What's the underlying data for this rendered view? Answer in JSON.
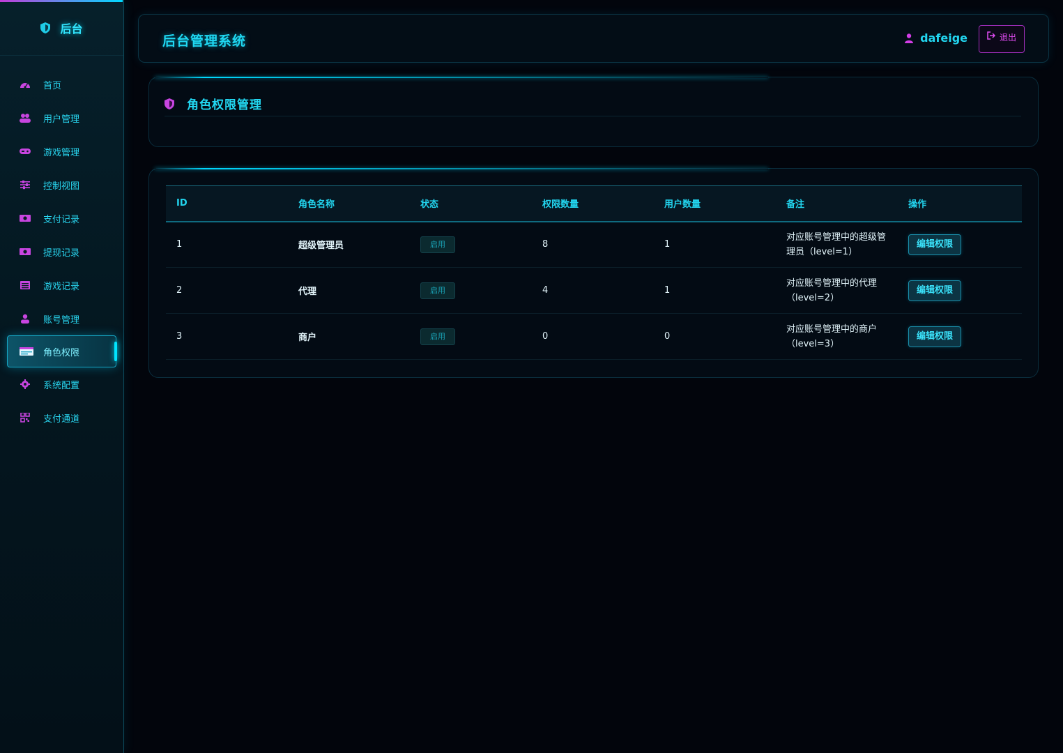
{
  "sidebar": {
    "brand": "后台",
    "items": [
      {
        "label": "首页",
        "icon": "dashboard-icon"
      },
      {
        "label": "用户管理",
        "icon": "users-icon"
      },
      {
        "label": "游戏管理",
        "icon": "gamepad-icon"
      },
      {
        "label": "控制视图",
        "icon": "sliders-icon"
      },
      {
        "label": "支付记录",
        "icon": "money-icon"
      },
      {
        "label": "提现记录",
        "icon": "money-icon"
      },
      {
        "label": "游戏记录",
        "icon": "list-icon"
      },
      {
        "label": "账号管理",
        "icon": "account-icon"
      },
      {
        "label": "角色权限",
        "icon": "id-card-icon",
        "active": true
      },
      {
        "label": "系统配置",
        "icon": "gear-icon"
      },
      {
        "label": "支付通道",
        "icon": "qrcode-icon"
      }
    ]
  },
  "header": {
    "title": "后台管理系统",
    "username": "dafeige",
    "logout_label": "退出"
  },
  "page": {
    "title": "角色权限管理"
  },
  "table": {
    "columns": [
      "ID",
      "角色名称",
      "状态",
      "权限数量",
      "用户数量",
      "备注",
      "操作"
    ],
    "rows": [
      {
        "id": "1",
        "name": "超级管理员",
        "status": "启用",
        "perm_count": "8",
        "user_count": "1",
        "note": "对应账号管理中的超级管理员（level=1）",
        "action": "编辑权限"
      },
      {
        "id": "2",
        "name": "代理",
        "status": "启用",
        "perm_count": "4",
        "user_count": "1",
        "note": "对应账号管理中的代理（level=2）",
        "action": "编辑权限"
      },
      {
        "id": "3",
        "name": "商户",
        "status": "启用",
        "perm_count": "0",
        "user_count": "0",
        "note": "对应账号管理中的商户（level=3）",
        "action": "编辑权限"
      }
    ]
  },
  "colors": {
    "accent": "#22d8f2",
    "magenta": "#e14cf2",
    "background": "#02050c"
  }
}
